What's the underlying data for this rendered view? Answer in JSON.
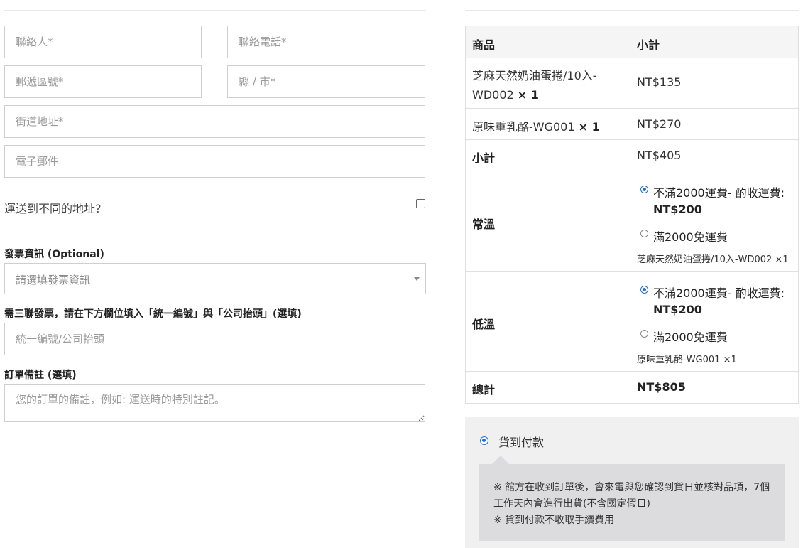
{
  "billing": {
    "contact_placeholder": "聯絡人*",
    "phone_placeholder": "聯絡電話*",
    "postcode_placeholder": "郵遞區號*",
    "city_placeholder": "縣 / 市*",
    "street_placeholder": "街道地址*",
    "email_placeholder": "電子郵件",
    "ship_different_label": "運送到不同的地址?",
    "invoice_label": "發票資訊 (Optional)",
    "invoice_select_value": "請選填發票資訊",
    "tax_id_label": "需三聯發票，請在下方欄位填入「統一編號」與「公司抬頭」(選填)",
    "tax_id_placeholder": "統一編號/公司抬頭",
    "notes_label": "訂單備註 (選填)",
    "notes_placeholder": "您的訂單的備註，例如: 運送時的特別註記。"
  },
  "order": {
    "col_product": "商品",
    "col_subtotal": "小計",
    "items": [
      {
        "name_line1": "芝麻天然奶油蛋捲/10入-",
        "name_line2": "WD002",
        "qty": "× 1",
        "price": "NT$135"
      },
      {
        "name_line1": "原味重乳酪-WG001",
        "qty": "× 1",
        "price": "NT$270"
      }
    ],
    "subtotal_label": "小計",
    "subtotal_value": "NT$405",
    "shipping": [
      {
        "label": "常溫",
        "option1": "不滿2000運費- 酌收運費:",
        "option1_price": "NT$200",
        "option2": "滿2000免運費",
        "items_note": "芝麻天然奶油蛋捲/10入-WD002 ×1"
      },
      {
        "label": "低溫",
        "option1": "不滿2000運費- 酌收運費:",
        "option1_price": "NT$200",
        "option2": "滿2000免運費",
        "items_note": "原味重乳酪-WG001 ×1"
      }
    ],
    "total_label": "總計",
    "total_value": "NT$805"
  },
  "payment": {
    "method_label": "貨到付款",
    "note_line1": "※ 館方在收到訂單後，會來電與您確認到貨日並核對品項，7個",
    "note_line2": "工作天內會進行出貨(不含國定假日)",
    "note_line3": "※ 貨到付款不收取手續費用"
  },
  "colors": {
    "accent": "#1e6fd9",
    "border": "#cfcfcf",
    "payment_bg": "#f0f0f1",
    "payment_box": "#dcdcde"
  }
}
